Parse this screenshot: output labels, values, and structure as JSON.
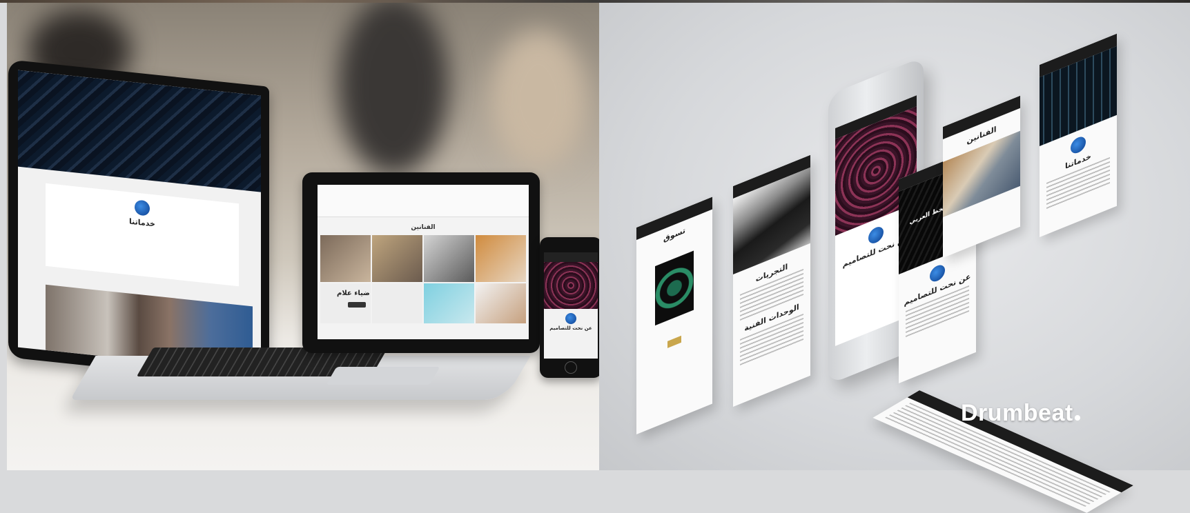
{
  "left_scene": {
    "laptop": {
      "about_title": "خدماتنا"
    },
    "tablet": {
      "section_title": "الفنانين",
      "artist_name": "ضياء علام"
    },
    "phone": {
      "title": "عن نحت للتصاميم"
    }
  },
  "right_scene": {
    "screens": {
      "shop_title": "تسوق",
      "events_title": "التجريات",
      "artworks_title": "الوحدات الفنية",
      "about_title": "عن نحت للتصاميم",
      "artists_title": "الفنانين",
      "services_title": "خدماتنا",
      "card_title": "عن نحت للتصاميم",
      "overlay_title": "حياة بالخط العربي"
    }
  },
  "watermark": {
    "text": "Drumbeat"
  },
  "colors": {
    "accent_blue": "#1e6fd1",
    "dark": "#111111"
  }
}
